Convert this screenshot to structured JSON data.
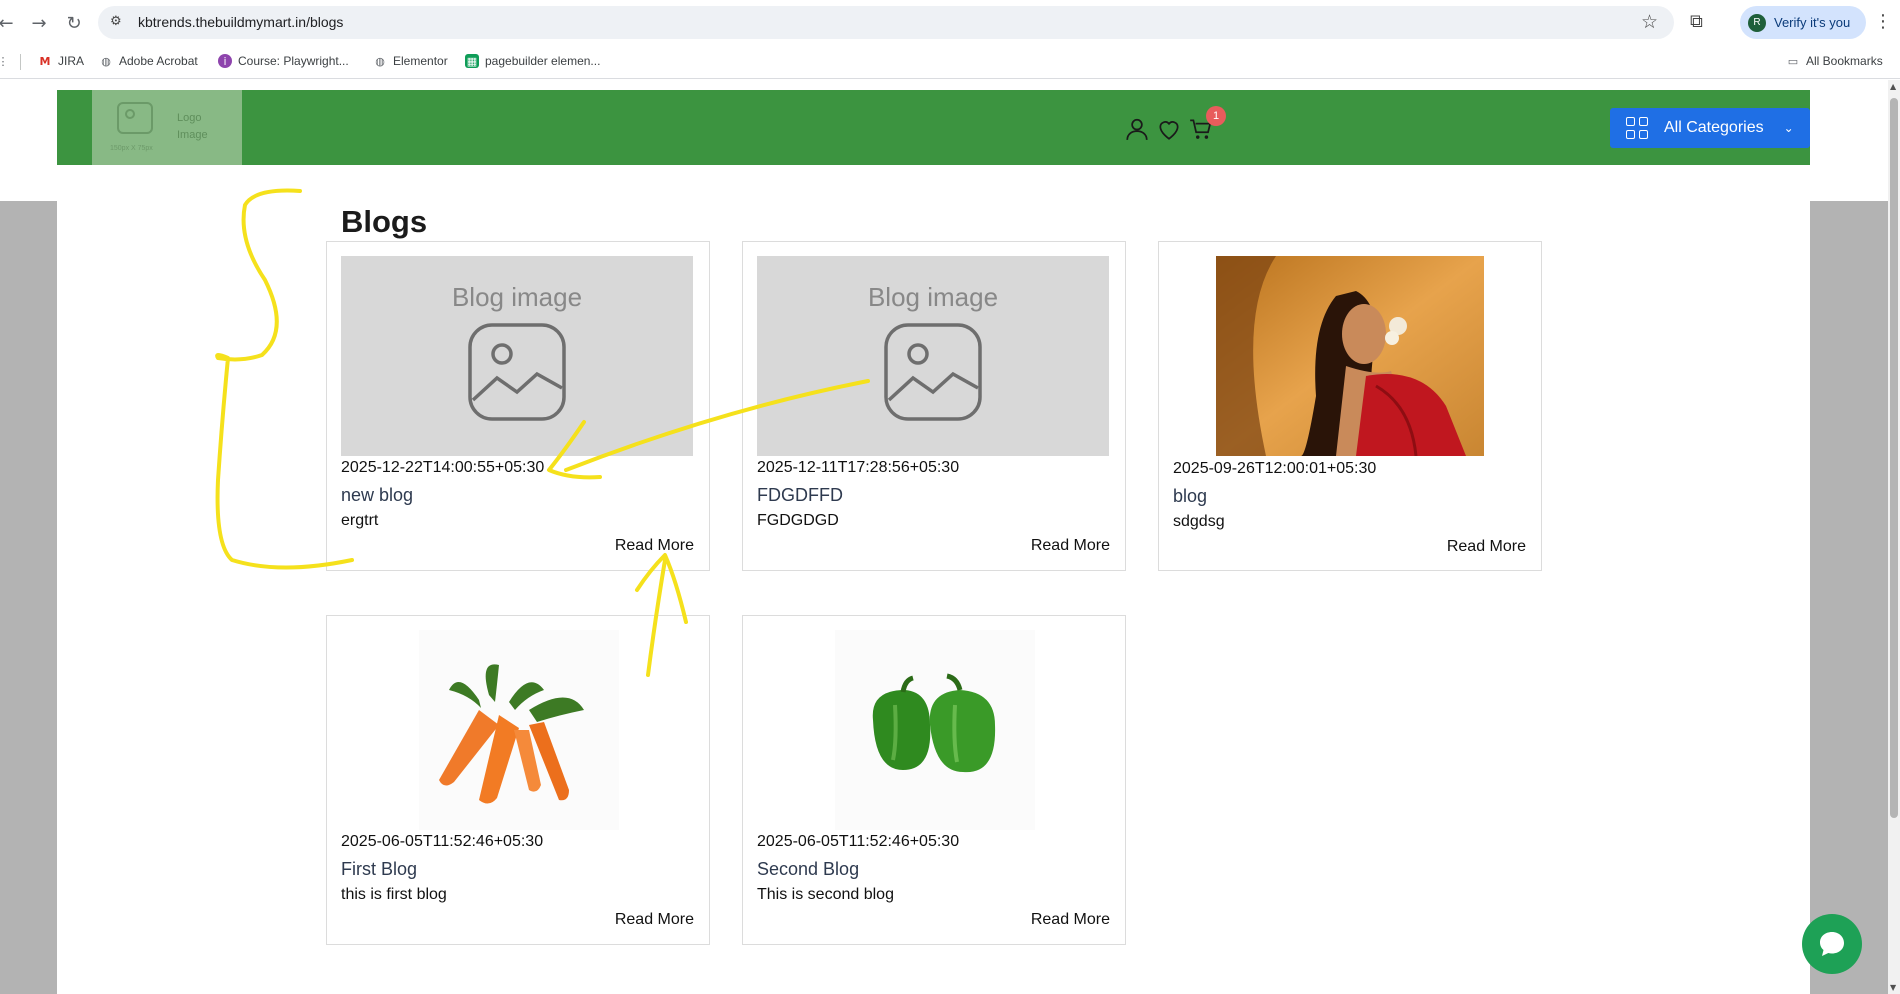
{
  "browser": {
    "url": "kbtrends.thebuildmymart.in/blogs",
    "verify_label": "Verify it's you",
    "profile_initial": "R",
    "bookmarks": [
      {
        "label": "JIRA",
        "icon": "gmail-icon"
      },
      {
        "label": "Adobe Acrobat",
        "icon": "globe-icon"
      },
      {
        "label": "Course: Playwright...",
        "icon": "course-icon"
      },
      {
        "label": "Elementor",
        "icon": "globe-icon"
      },
      {
        "label": "pagebuilder elemen...",
        "icon": "sheets-icon"
      }
    ],
    "all_bookmarks_label": "All Bookmarks"
  },
  "header": {
    "logo_text": "Logo Image",
    "logo_dims": "150px X 75px",
    "cart_count": "1",
    "all_categories_label": "All Categories",
    "brand_color": "#3c9440",
    "accent_color": "#1f6fe5"
  },
  "blogs": {
    "heading": "Blogs",
    "read_more_label": "Read More",
    "placeholder_label": "Blog image",
    "cards": [
      {
        "date": "2025-12-22T14:00:55+05:30",
        "title": "new blog",
        "excerpt": "ergtrt",
        "image": "placeholder"
      },
      {
        "date": "2025-12-11T17:28:56+05:30",
        "title": "FDGDFFD",
        "excerpt": "FGDGDGD",
        "image": "placeholder"
      },
      {
        "date": "2025-09-26T12:00:01+05:30",
        "title": "blog",
        "excerpt": "sdgdsg",
        "image": "woman-photo"
      },
      {
        "date": "2025-06-05T11:52:46+05:30",
        "title": "First Blog",
        "excerpt": "this is first blog",
        "image": "carrots-photo"
      },
      {
        "date": "2025-06-05T11:52:46+05:30",
        "title": "Second Blog",
        "excerpt": "This is second blog",
        "image": "peppers-photo"
      }
    ]
  },
  "chat": {
    "icon": "chat-bubble-icon",
    "color": "#1ea156"
  }
}
